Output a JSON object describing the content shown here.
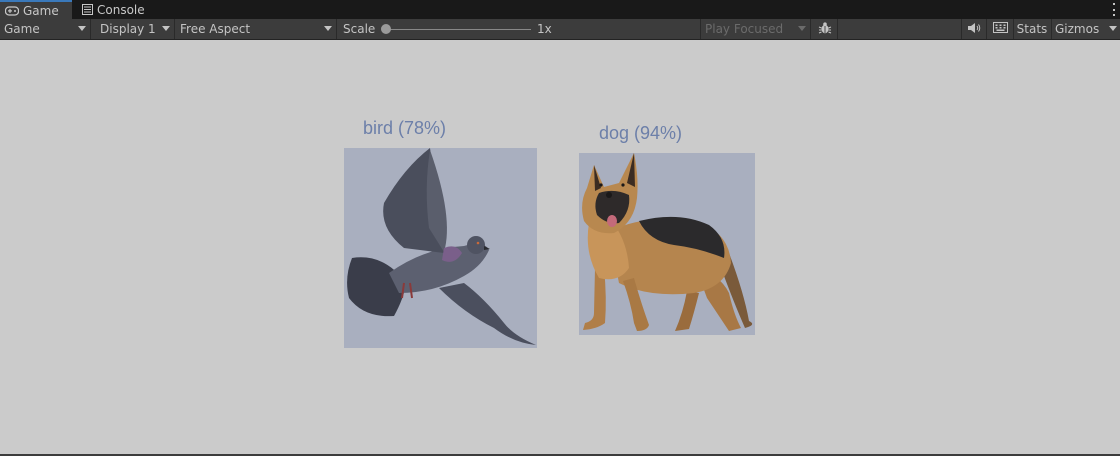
{
  "tabs": {
    "game": {
      "label": "Game",
      "icon": "gamepad-icon"
    },
    "console": {
      "label": "Console",
      "icon": "console-icon"
    }
  },
  "toolbar": {
    "view_dropdown": "Game",
    "display_dropdown": "Display 1",
    "aspect_dropdown": "Free Aspect",
    "scale_label": "Scale",
    "scale_value": "1x",
    "scale_fraction": 0.0,
    "play_focused": "Play Focused",
    "stats_label": "Stats",
    "gizmos_label": "Gizmos"
  },
  "detections": [
    {
      "label": "bird (78%)",
      "subject": "pigeon"
    },
    {
      "label": "dog (94%)",
      "subject": "german-shepherd"
    }
  ],
  "colors": {
    "accent": "#3a79bb",
    "label_text": "#6c7fa9",
    "box_fill": "#a9afbf",
    "viewport_bg": "#cbcbcb"
  }
}
